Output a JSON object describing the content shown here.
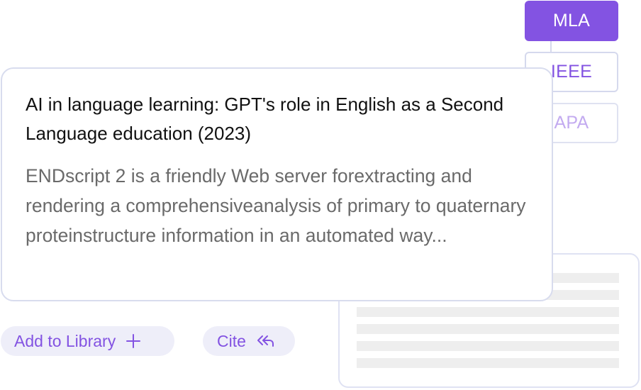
{
  "citation_styles": {
    "active": "MLA",
    "items": [
      {
        "label": "MLA"
      },
      {
        "label": "IEEE"
      },
      {
        "label": "APA"
      }
    ]
  },
  "paper": {
    "title": "AI in language learning: GPT's role in English as a Second Language education (2023)",
    "abstract": "ENDscript 2 is a friendly Web server forextracting and rendering a comprehensiveanalysis of primary to quaternary proteinstructure information in an automated way..."
  },
  "actions": {
    "add_to_library": "Add to Library",
    "cite": "Cite"
  },
  "icons": {
    "add": "plus-icon",
    "cite": "double-reply-icon"
  },
  "colors": {
    "accent": "#8353e2",
    "pill_bg": "#eeeef9",
    "border": "#d8dcee"
  }
}
